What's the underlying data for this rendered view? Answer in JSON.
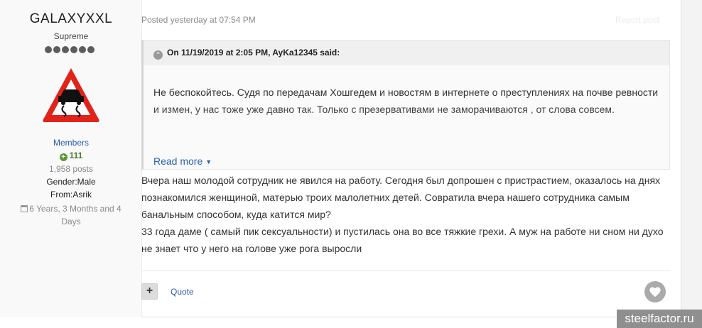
{
  "author": {
    "username": "GALAXYXXL",
    "rank": "Supreme",
    "pips": 6,
    "group": "Members",
    "reputation": "111",
    "posts": "1,958 posts",
    "gender": "Gender:Male",
    "from": "From:Asrik",
    "joined": "6 Years, 3 Months and 4 Days"
  },
  "post": {
    "posted": "Posted yesterday at 07:54 PM",
    "report_label": "Report post",
    "quote_header": "On 11/19/2019 at 2:05 PM, AyKa12345 said:",
    "quote_text": "Не беспокойтесь.  Судя по передачам Хошгедем и новостям в интернете о  преступлениях на почве ревности и измен, у нас тоже уже давно так. Только с презервативами не заморачиваются , от слова совсем.",
    "read_more": "Read more",
    "body_text": "Вчера наш молодой сотрудник не явился на работу. Сегодня был допрошен с пристрастием, оказалось на днях познакомился женщиной, матерью троих малолетних детей. Совратила вчера нашего сотрудника самым банальным способом, куда катится мир?\n33 года даме ( самый пик сексуальности) и пустилась она во все тяжкие грехи. А муж на работе ни сном ни духо не знает что у него на голове уже рога выросли"
  },
  "actions": {
    "multiquote_label": "+",
    "quote_label": "Quote"
  },
  "watermark": "steelfactor.ru",
  "colors": {
    "link": "#2a5db0",
    "reputation": "#497e2b",
    "warning_red": "#e2231a"
  },
  "icons": {
    "pips": "rank-pip-icon",
    "avatar": "slippery-road-warning-sign",
    "reputation": "plus-circle-icon",
    "joined": "calendar-icon",
    "quote": "chevron-circle-icon",
    "like": "heart-icon"
  }
}
